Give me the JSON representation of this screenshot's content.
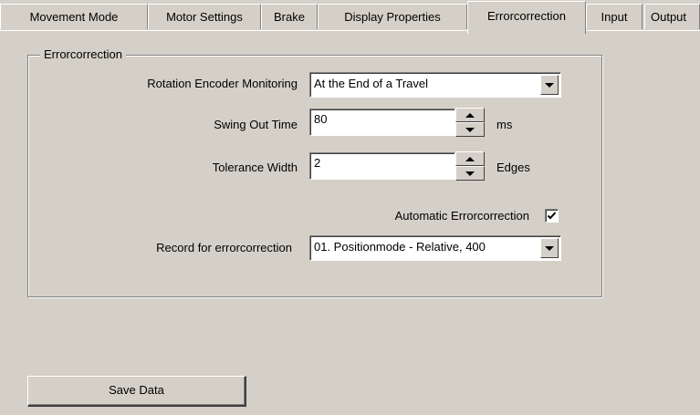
{
  "tabs": [
    {
      "label": "Movement Mode",
      "active": false
    },
    {
      "label": "Motor Settings",
      "active": false
    },
    {
      "label": "Brake",
      "active": false
    },
    {
      "label": "Display Properties",
      "active": false
    },
    {
      "label": "Errorcorrection",
      "active": true
    },
    {
      "label": "Input",
      "active": false
    },
    {
      "label": "Output",
      "active": false
    }
  ],
  "group": {
    "title": "Errorcorrection",
    "rotation_encoder": {
      "label": "Rotation Encoder Monitoring",
      "value": "At the End of a Travel"
    },
    "swing_out_time": {
      "label": "Swing Out Time",
      "value": "80",
      "unit": "ms"
    },
    "tolerance_width": {
      "label": "Tolerance Width",
      "value": "2",
      "unit": "Edges"
    },
    "automatic": {
      "label": "Automatic Errorcorrection",
      "checked": true
    },
    "record": {
      "label": "Record for errorcorrection",
      "value": "01. Positionmode - Relative,  400"
    }
  },
  "save_button": {
    "label": "Save Data"
  }
}
